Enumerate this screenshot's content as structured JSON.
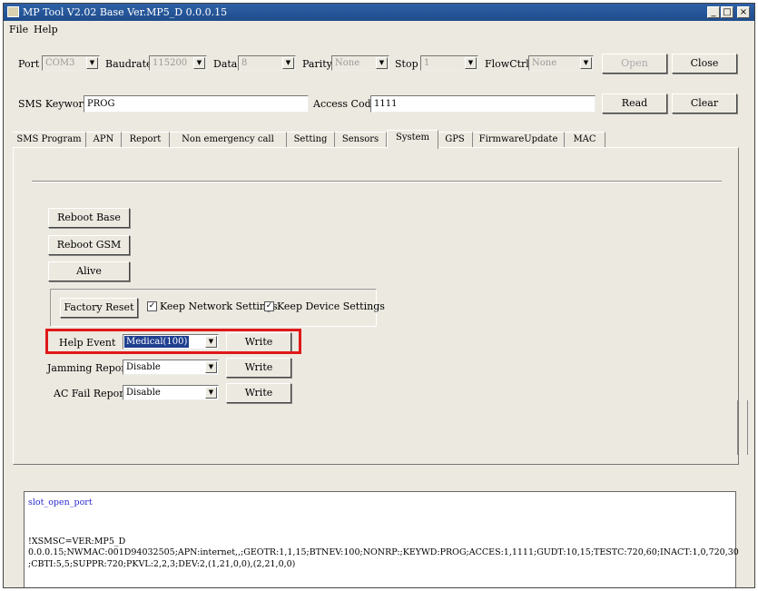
{
  "window": {
    "title": "MP Tool V2.02  Base Ver.MP5_D 0.0.0.15"
  },
  "menu": {
    "file": "File",
    "help": "Help"
  },
  "serial": {
    "port_label": "Port",
    "port_value": "COM3",
    "baudrate_label": "Baudrate",
    "baudrate_value": "115200",
    "data_label": "Data",
    "data_value": "8",
    "parity_label": "Parity",
    "parity_value": "None",
    "stop_label": "Stop",
    "stop_value": "1",
    "flowctrl_label": "FlowCtrl",
    "flowctrl_value": "None",
    "open_label": "Open",
    "close_label": "Close"
  },
  "sms": {
    "keyword_label": "SMS Keyword",
    "keyword_value": "PROG",
    "access_label": "Access Code",
    "access_value": "1111",
    "read_label": "Read",
    "clear_label": "Clear"
  },
  "tabs": [
    "SMS Program",
    "APN",
    "Report",
    "Non emergency call",
    "Setting",
    "Sensors",
    "System",
    "GPS",
    "FirmwareUpdate",
    "MAC"
  ],
  "active_tab": "System",
  "system": {
    "reboot_base": "Reboot Base",
    "reboot_gsm": "Reboot GSM",
    "alive": "Alive",
    "factory_reset": "Factory Reset",
    "keep_network": "Keep Network Settings",
    "keep_device": "Keep Device Settings",
    "keep_network_checked": true,
    "keep_device_checked": true,
    "help_event_label": "Help Event",
    "help_event_value": "Medical(100)",
    "jamming_label": "Jamming Report",
    "jamming_value": "Disable",
    "acfail_label": "AC Fail Report",
    "acfail_value": "Disable",
    "write_label": "Write"
  },
  "log": {
    "line1": "slot_open_port",
    "line2": "!XSMSC=VER:MP5_D",
    "line3": "0.0.0.15;NWMAC:001D94032505;APN:internet,,;GEOTR:1,1,15;BTNEV:100;NONRP:;KEYWD:PROG;ACCES:1,1111;GUDT:10,15;TESTC:720,60;INACT:1,0,720,30",
    "line4": ";CBTI:5,5;SUPPR:720;PKVL:2,2,3;DEV:2,(1,21,0,0),(2,21,0,0)",
    "link_color": "#2a2ad0"
  }
}
